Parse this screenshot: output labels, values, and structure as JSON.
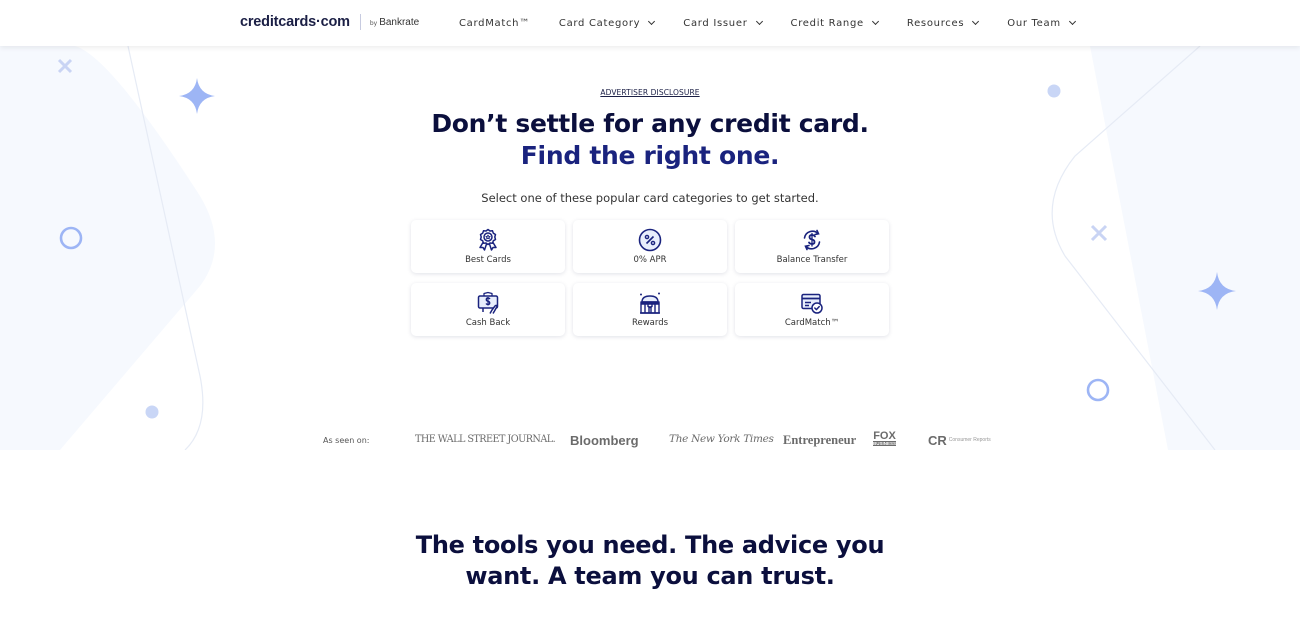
{
  "nav": {
    "logo": {
      "main": "creditcards·com",
      "by": "by",
      "partner": "Bankrate"
    },
    "items": [
      {
        "label": "CardMatch™",
        "dropdown": false
      },
      {
        "label": "Card Category",
        "dropdown": true
      },
      {
        "label": "Card Issuer",
        "dropdown": true
      },
      {
        "label": "Credit Range",
        "dropdown": true
      },
      {
        "label": "Resources",
        "dropdown": true
      },
      {
        "label": "Our Team",
        "dropdown": true
      }
    ]
  },
  "hero": {
    "disclosure": "ADVERTISER DISCLOSURE",
    "title_line1": "Don’t settle for any credit card.",
    "title_line2": "Find the right one.",
    "subtitle": "Select one of these popular card categories to get started.",
    "categories": [
      {
        "label": "Best Cards",
        "icon": "award-ribbon-icon"
      },
      {
        "label": "0% APR",
        "icon": "percent-icon"
      },
      {
        "label": "Balance Transfer",
        "icon": "dollar-transfer-icon"
      },
      {
        "label": "Cash Back",
        "icon": "cash-back-icon"
      },
      {
        "label": "Rewards",
        "icon": "rewards-store-icon"
      },
      {
        "label": "CardMatch™",
        "icon": "card-check-icon"
      }
    ]
  },
  "as_seen_on": {
    "label": "As seen on:",
    "publications": [
      "THE WALL STREET JOURNAL.",
      "Bloomberg",
      "The New York Times",
      "Entrepreneur",
      "FOX",
      "CR"
    ],
    "fox_sub": "BUSINESS",
    "cr_sub": "Consumer Reports"
  },
  "section2": {
    "title_line1": "The tools you need. The advice you",
    "title_line2": "want. A team you can trust."
  },
  "colors": {
    "navy": "#0b0f3d",
    "accent_blue": "#1a237e",
    "decor_blue": "#9db5f5"
  }
}
